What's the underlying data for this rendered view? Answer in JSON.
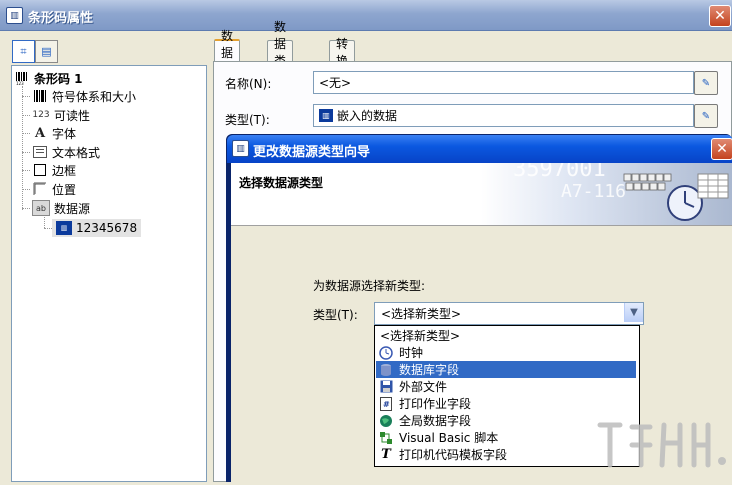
{
  "window": {
    "title": "条形码属性",
    "close_glyph": "✕"
  },
  "tree": {
    "root_label": "条形码 1",
    "items": [
      {
        "label": "符号体系和大小",
        "icon": "barcode-icon"
      },
      {
        "label": "可读性",
        "icon": "readability-icon",
        "prefix": "123"
      },
      {
        "label": "字体",
        "icon": "font-icon"
      },
      {
        "label": "文本格式",
        "icon": "text-format-icon"
      },
      {
        "label": "边框",
        "icon": "border-icon"
      },
      {
        "label": "位置",
        "icon": "position-icon"
      },
      {
        "label": "数据源",
        "icon": "datasource-icon"
      }
    ],
    "child_label": "12345678"
  },
  "tabs": [
    {
      "label": "数据源",
      "active": true
    },
    {
      "label": "数据类型",
      "active": false
    },
    {
      "label": "转换",
      "active": false
    }
  ],
  "form": {
    "name_label": "名称(N):",
    "name_value": "<无>",
    "type_label": "类型(T):",
    "type_value": "嵌入的数据"
  },
  "wizard": {
    "title": "更改数据源类型向导",
    "heading": "选择数据源类型",
    "banner_text": "3597001",
    "banner_text2": "A7-116",
    "prompt": "为数据源选择新类型:",
    "type_label": "类型(T):",
    "combo_value": "<选择新类型>",
    "options": [
      {
        "label": "<选择新类型>",
        "icon": "",
        "highlighted": false
      },
      {
        "label": "时钟",
        "icon": "clock-icon",
        "highlighted": false
      },
      {
        "label": "数据库字段",
        "icon": "database-icon",
        "highlighted": true
      },
      {
        "label": "外部文件",
        "icon": "floppy-icon",
        "highlighted": false
      },
      {
        "label": "打印作业字段",
        "icon": "print-job-icon",
        "highlighted": false
      },
      {
        "label": "全局数据字段",
        "icon": "globe-icon",
        "highlighted": false
      },
      {
        "label": "Visual Basic 脚本",
        "icon": "vb-script-icon",
        "highlighted": false
      },
      {
        "label": "打印机代码模板字段",
        "icon": "printer-code-icon",
        "highlighted": false
      }
    ]
  },
  "colors": {
    "titlebar_blue": "#0b58e0",
    "highlight": "#316ac5",
    "close_red": "#c4431f"
  }
}
